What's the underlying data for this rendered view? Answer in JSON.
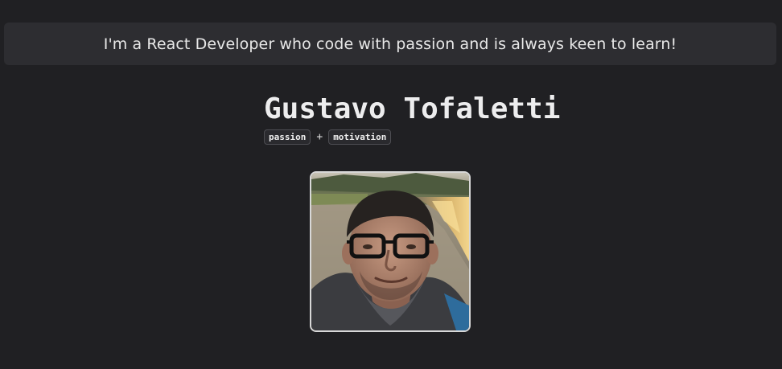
{
  "banner": {
    "text": "I'm a React Developer who code with passion and is always keen to learn!"
  },
  "profile": {
    "name": "Gustavo Tofaletti",
    "tags": [
      "passion",
      "motivation"
    ],
    "separator": "+"
  }
}
